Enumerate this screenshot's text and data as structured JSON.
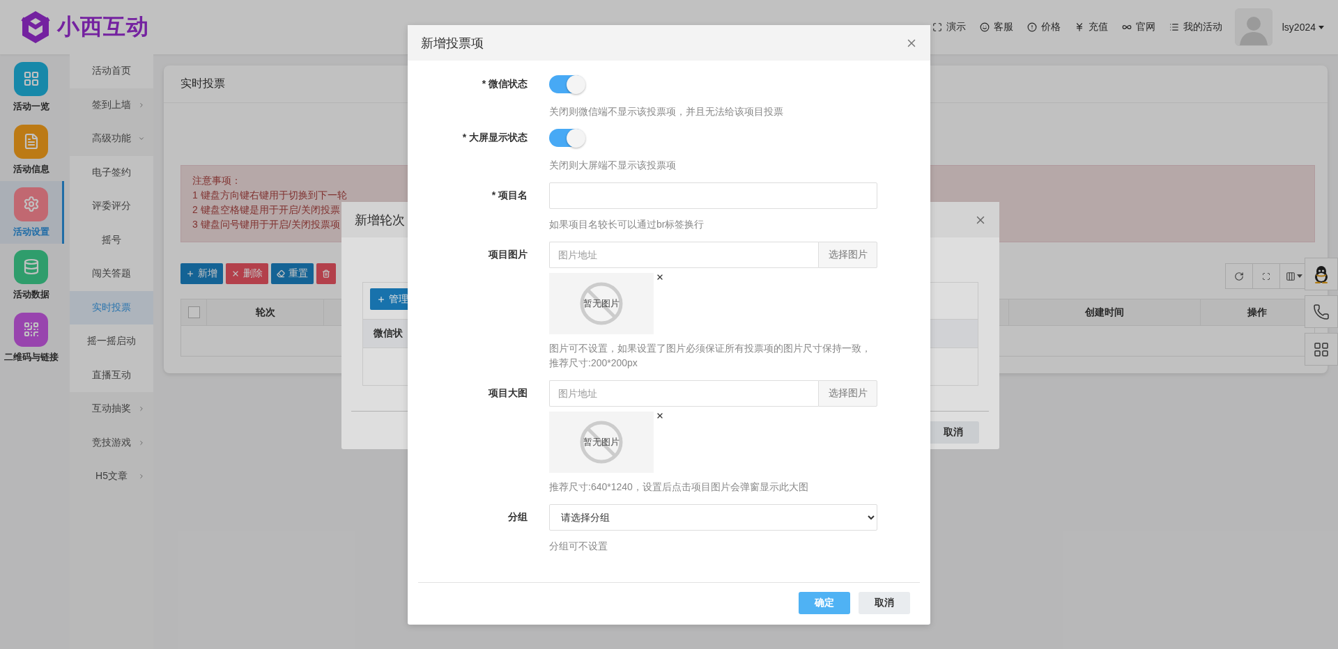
{
  "logo": {
    "text": "小西互动"
  },
  "top_nav": [
    {
      "label": "演示"
    },
    {
      "label": "客服"
    },
    {
      "label": "价格"
    },
    {
      "label": "充值"
    },
    {
      "label": "官网"
    },
    {
      "label": "我的活动"
    }
  ],
  "user": {
    "name": "lsy2024"
  },
  "sidebar": [
    {
      "label": "活动一览",
      "selected": false
    },
    {
      "label": "活动信息",
      "selected": false
    },
    {
      "label": "活动设置",
      "selected": true
    },
    {
      "label": "活动数据",
      "selected": false
    },
    {
      "label": "二维码与链接",
      "selected": false
    }
  ],
  "submenu": [
    {
      "label": "活动首页",
      "kind": "link",
      "selected": false
    },
    {
      "label": "签到上墙",
      "kind": "group",
      "selected": false,
      "expanded": false
    },
    {
      "label": "高级功能",
      "kind": "group",
      "selected": false,
      "expanded": true,
      "children": [
        {
          "label": "电子签约",
          "selected": false
        },
        {
          "label": "评委评分",
          "selected": false
        },
        {
          "label": "摇号",
          "selected": false
        },
        {
          "label": "闯关答题",
          "selected": false
        },
        {
          "label": "实时投票",
          "selected": true
        },
        {
          "label": "摇一摇启动",
          "selected": false
        },
        {
          "label": "直播互动",
          "selected": false
        }
      ]
    },
    {
      "label": "互动抽奖",
      "kind": "group",
      "selected": false,
      "expanded": false
    },
    {
      "label": "竞技游戏",
      "kind": "group",
      "selected": false,
      "expanded": false
    },
    {
      "label": "H5文章",
      "kind": "group",
      "selected": false,
      "expanded": false
    }
  ],
  "page": {
    "title": "实时投票",
    "notice": {
      "title": "注意事项：",
      "lines": [
        "1 键盘方向键右键用于切换到下一轮",
        "2 键盘空格键是用于开启/关闭投票",
        "3 键盘问号键用于开启/关闭投票项"
      ]
    },
    "actions": [
      {
        "label": "新增",
        "kind": "primary"
      },
      {
        "label": "删除",
        "kind": "danger"
      },
      {
        "label": "重置",
        "kind": "primary"
      },
      {
        "kind": "danger"
      }
    ],
    "table": {
      "checked": false,
      "columns": [
        "轮次",
        "创建时间",
        "操作"
      ]
    }
  },
  "round_dialog": {
    "title": "新增轮次",
    "add_label": "管理",
    "column": "微信状",
    "cancel": "取消"
  },
  "item_dialog": {
    "title": "新增投票项",
    "fields": [
      {
        "kind": "switch",
        "label": "* 微信状态",
        "on": true,
        "help": "关闭则微信端不显示该投票项，并且无法给该项目投票"
      },
      {
        "kind": "switch",
        "label": "* 大屏显示状态",
        "on": true,
        "help": "关闭则大屏端不显示该投票项"
      },
      {
        "kind": "text",
        "label": "* 项目名",
        "help": "如果项目名较长可以通过br标签换行"
      },
      {
        "kind": "image",
        "label": "项目图片",
        "placeholder": "图片地址",
        "button": "选择图片",
        "empty_text": "暂无图片",
        "help": "图片可不设置，如果设置了图片必须保证所有投票项的图片尺寸保持一致，推荐尺寸:200*200px"
      },
      {
        "kind": "image",
        "label": "项目大图",
        "placeholder": "图片地址",
        "button": "选择图片",
        "empty_text": "暂无图片",
        "help": "推荐尺寸:640*1240，设置后点击项目图片会弹窗显示此大图"
      },
      {
        "kind": "select",
        "label": "分组",
        "value": "请选择分组",
        "help": "分组可不设置"
      }
    ],
    "confirm": "确定",
    "cancel": "取消"
  }
}
